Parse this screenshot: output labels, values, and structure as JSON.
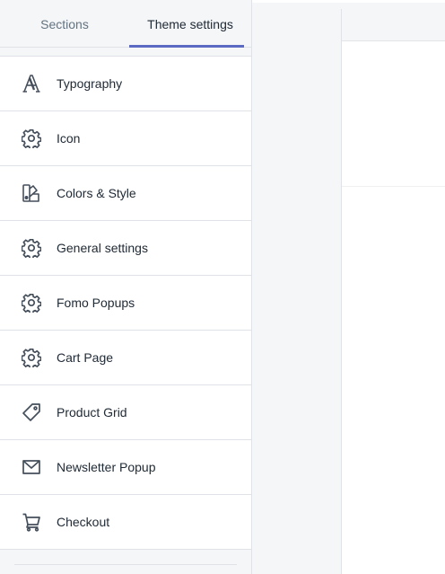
{
  "tabs": {
    "sections": "Sections",
    "theme_settings": "Theme settings",
    "active": "theme_settings"
  },
  "menu": {
    "items": [
      {
        "label": "Typography",
        "icon": "typography-icon"
      },
      {
        "label": "Icon",
        "icon": "gear-icon"
      },
      {
        "label": "Colors & Style",
        "icon": "paint-palette-icon"
      },
      {
        "label": "General settings",
        "icon": "gear-icon"
      },
      {
        "label": "Fomo Popups",
        "icon": "gear-icon"
      },
      {
        "label": "Cart Page",
        "icon": "gear-icon"
      },
      {
        "label": "Product Grid",
        "icon": "tag-icon"
      },
      {
        "label": "Newsletter Popup",
        "icon": "envelope-icon"
      },
      {
        "label": "Checkout",
        "icon": "cart-icon"
      }
    ]
  },
  "colors": {
    "accent": "#5c6ac4",
    "text": "#212b36",
    "muted": "#637381",
    "border": "#dfe3e8",
    "background": "#f4f6f8"
  }
}
